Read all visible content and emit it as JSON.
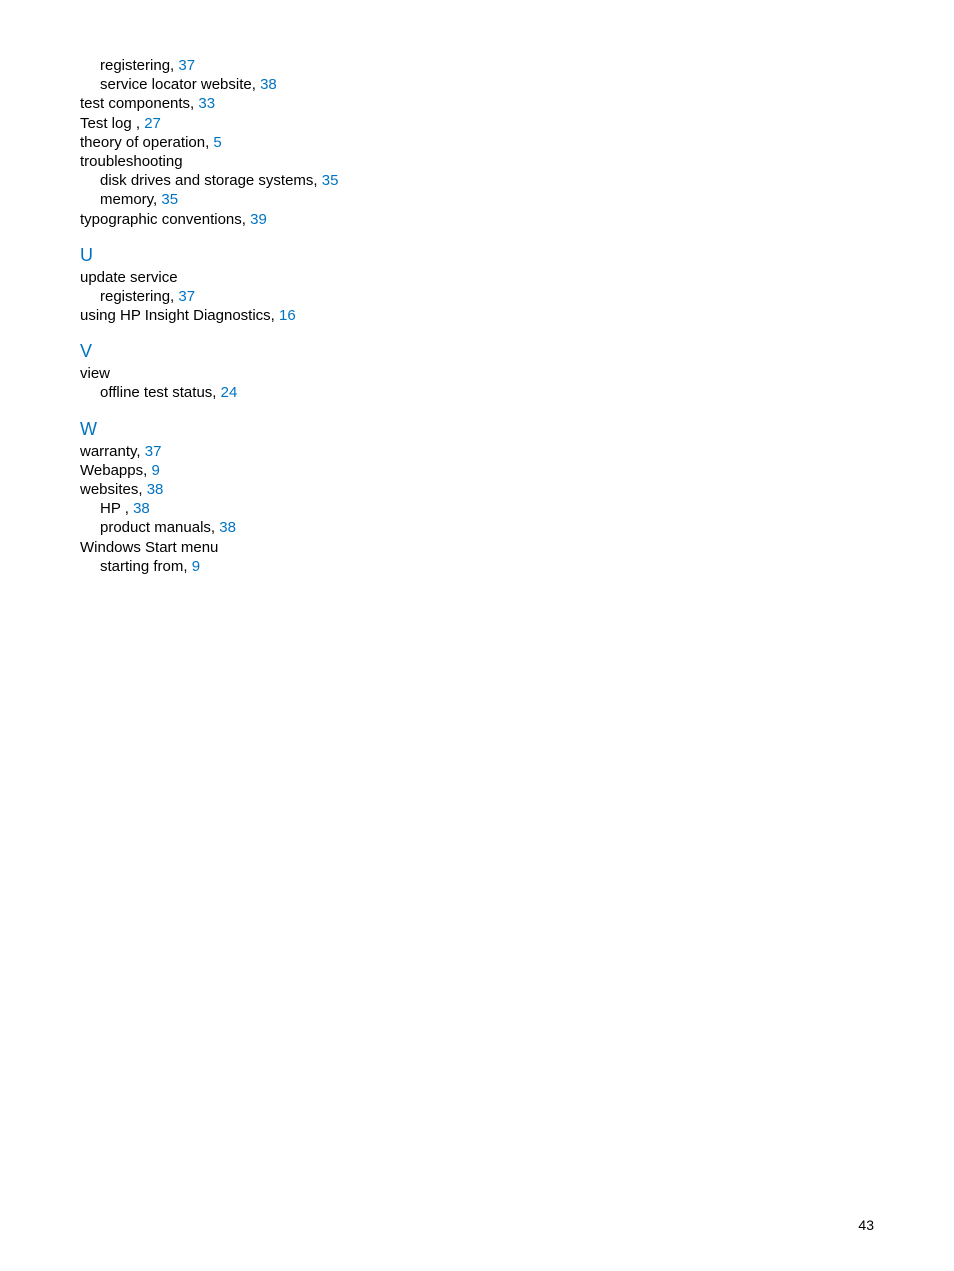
{
  "page_number": "43",
  "sections": {
    "pre": {
      "entries": [
        {
          "indent": 1,
          "text": "registering, ",
          "page": "37"
        },
        {
          "indent": 1,
          "text": "service locator website, ",
          "page": "38"
        },
        {
          "indent": 0,
          "text": "test components, ",
          "page": "33"
        },
        {
          "indent": 0,
          "text": "Test log , ",
          "page": "27"
        },
        {
          "indent": 0,
          "text": "theory of operation, ",
          "page": "5"
        },
        {
          "indent": 0,
          "text": "troubleshooting",
          "page": ""
        },
        {
          "indent": 1,
          "text": "disk drives and storage systems, ",
          "page": "35"
        },
        {
          "indent": 1,
          "text": "memory, ",
          "page": "35"
        },
        {
          "indent": 0,
          "text": "typographic conventions, ",
          "page": "39"
        }
      ]
    },
    "U": {
      "letter": "U",
      "entries": [
        {
          "indent": 0,
          "text": "update service",
          "page": ""
        },
        {
          "indent": 1,
          "text": "registering, ",
          "page": "37"
        },
        {
          "indent": 0,
          "text": "using HP Insight Diagnostics, ",
          "page": "16"
        }
      ]
    },
    "V": {
      "letter": "V",
      "entries": [
        {
          "indent": 0,
          "text": "view",
          "page": ""
        },
        {
          "indent": 1,
          "text": "offline test status, ",
          "page": "24"
        }
      ]
    },
    "W": {
      "letter": "W",
      "entries": [
        {
          "indent": 0,
          "text": "warranty, ",
          "page": "37"
        },
        {
          "indent": 0,
          "text": "Webapps, ",
          "page": "9"
        },
        {
          "indent": 0,
          "text": "websites, ",
          "page": "38"
        },
        {
          "indent": 1,
          "text": "HP , ",
          "page": "38"
        },
        {
          "indent": 1,
          "text": "product manuals, ",
          "page": "38"
        },
        {
          "indent": 0,
          "text": "Windows Start menu",
          "page": ""
        },
        {
          "indent": 1,
          "text": "starting from, ",
          "page": "9"
        }
      ]
    }
  }
}
